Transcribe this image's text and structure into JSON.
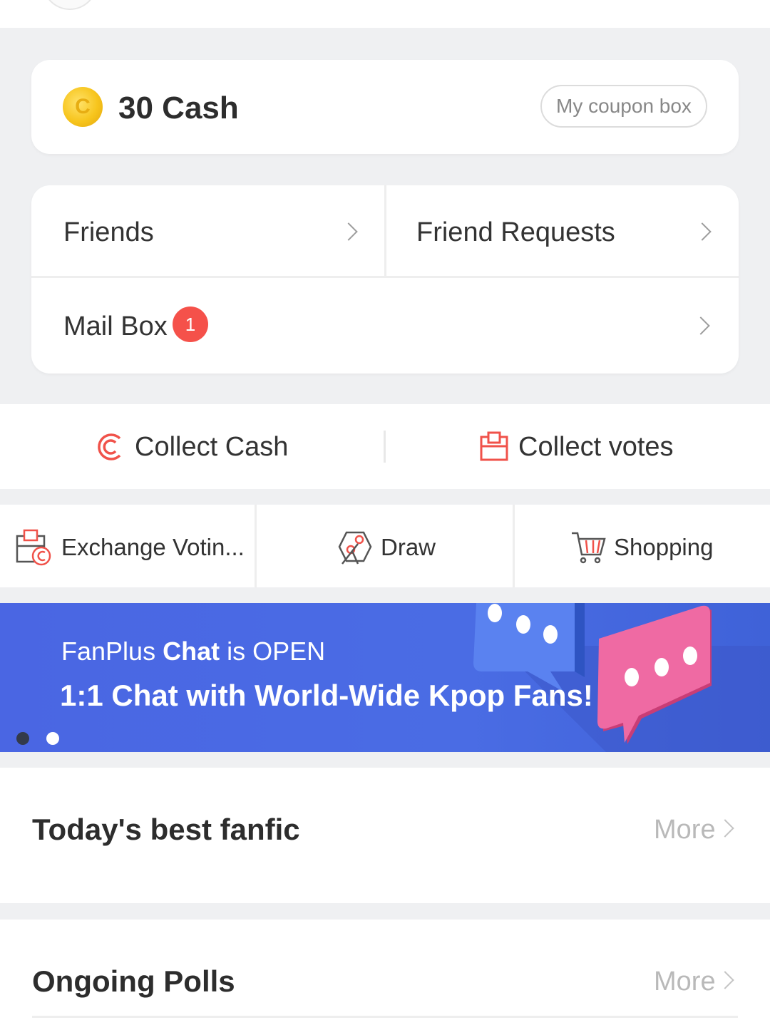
{
  "wallet": {
    "coin_icon": "coin-icon",
    "cash_amount": "30 Cash",
    "coupon_button": "My coupon box"
  },
  "menu": {
    "friends": "Friends",
    "friend_requests": "Friend Requests",
    "mail_box": "Mail Box",
    "mail_badge": "1"
  },
  "collect": {
    "cash_label": "Collect Cash",
    "votes_label": "Collect votes"
  },
  "actions": {
    "exchange": "Exchange Votin...",
    "draw": "Draw",
    "shopping": "Shopping"
  },
  "banner": {
    "sub_prefix": "FanPlus ",
    "sub_bold": "Chat",
    "sub_suffix": " is OPEN",
    "main": "1:1 Chat with World-Wide Kpop Fans!",
    "active_slide": 1,
    "slide_count": 2
  },
  "sections": {
    "fanfic_title": "Today's best fanfic",
    "fanfic_more": "More",
    "polls_title": "Ongoing Polls",
    "polls_more": "More"
  },
  "colors": {
    "accent_red": "#f5514a",
    "banner_blue": "#4a66e3",
    "coin_gold": "#f7c51d"
  }
}
